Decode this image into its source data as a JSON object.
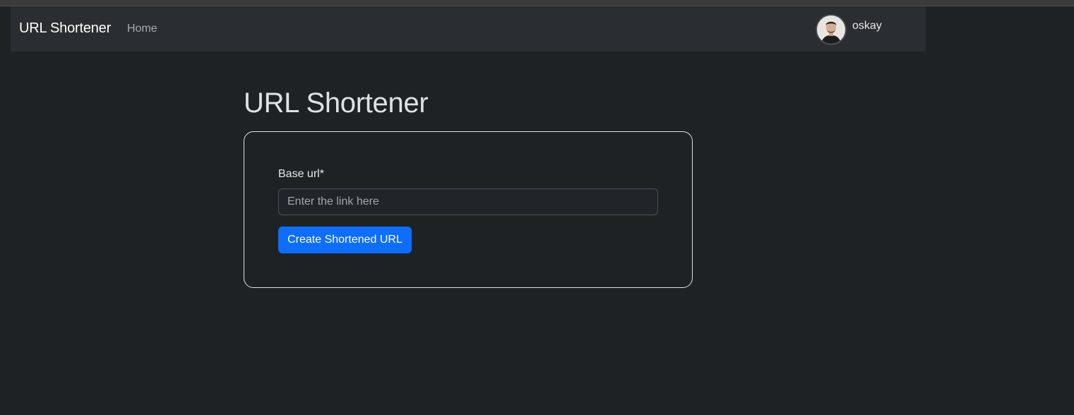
{
  "navbar": {
    "brand": "URL Shortener",
    "links": [
      {
        "label": "Home"
      }
    ],
    "user": {
      "name": "oskay",
      "avatar_icon": "user-avatar"
    }
  },
  "main": {
    "title": "URL Shortener",
    "form": {
      "url_label": "Base url*",
      "url_value": "",
      "url_placeholder": "Enter the link here",
      "submit_label": "Create Shortened URL"
    }
  },
  "colors": {
    "background": "#1f2225",
    "navbar": "#2a2d31",
    "primary": "#0d6efd",
    "card_border": "#dee2e6"
  }
}
